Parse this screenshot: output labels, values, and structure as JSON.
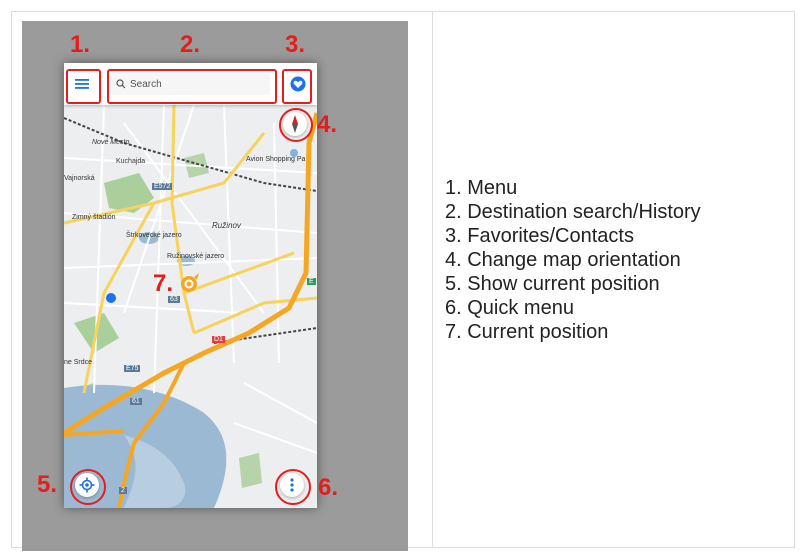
{
  "search": {
    "placeholder": "Search"
  },
  "callouts": {
    "n1": "1.",
    "n2": "2.",
    "n3": "3.",
    "n4": "4.",
    "n5": "5.",
    "n6": "6.",
    "n7": "7."
  },
  "map_labels": {
    "nove_mesto": "Nové Mesto",
    "kuchajda": "Kuchajda",
    "avion": "Avion Shopping Pa",
    "vajnorska": "Vajnorská",
    "e572": "E572",
    "stadion": "Zimný štadión",
    "ruzinov": "Ružinov",
    "strkovec": "Štrkovecké jazero",
    "ruzinovske": "Ružinovské jazero",
    "d1": "D1",
    "e75": "E75",
    "road_61": "61",
    "road_63": "63",
    "road_2": "2",
    "e_right": "E",
    "ne_label": "ne Srdce"
  },
  "legend": [
    "1. Menu",
    "2. Destination search/History",
    "3. Favorites/Contacts",
    "4. Change map orientation",
    "5. Show current position",
    "6. Quick menu",
    "7. Current position"
  ],
  "colors": {
    "callout": "#e41e1e",
    "accent": "#1a73e8",
    "route": "#f5a623",
    "water": "#9cb9d3",
    "park": "#9fc98c"
  }
}
